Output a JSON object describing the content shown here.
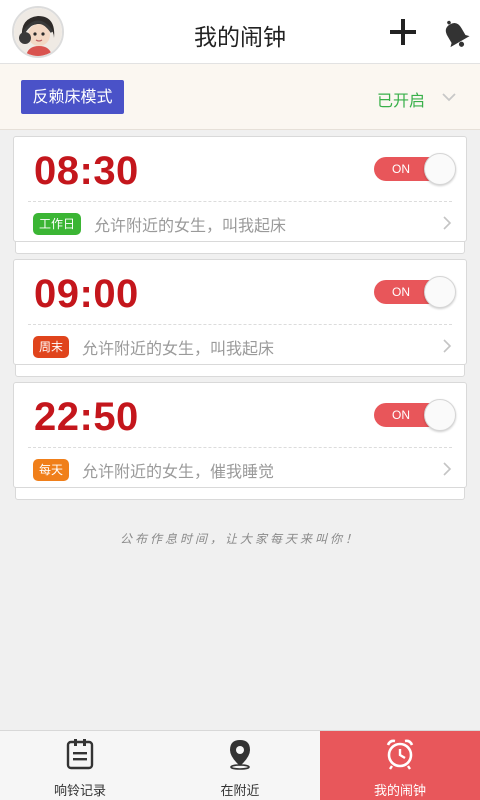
{
  "header": {
    "title": "我的闹钟",
    "add_icon": "plus-icon",
    "bell_icon": "bell-icon"
  },
  "mode": {
    "label": "反赖床模式",
    "status": "已开启"
  },
  "alarms": [
    {
      "time": "08:30",
      "toggle": "ON",
      "tag": "工作日",
      "tag_color": "#3bb534",
      "desc": "允许附近的女生，叫我起床"
    },
    {
      "time": "09:00",
      "toggle": "ON",
      "tag": "周末",
      "tag_color": "#e0441c",
      "desc": "允许附近的女生，叫我起床"
    },
    {
      "time": "22:50",
      "toggle": "ON",
      "tag": "每天",
      "tag_color": "#f07f1a",
      "desc": "允许附近的女生，催我睡觉"
    }
  ],
  "footer_note": "公布作息时间，让大家每天来叫你！",
  "tabs": [
    {
      "label": "响铃记录",
      "icon": "clipboard-icon"
    },
    {
      "label": "在附近",
      "icon": "location-pin-icon"
    },
    {
      "label": "我的闹钟",
      "icon": "alarm-clock-icon"
    }
  ],
  "colors": {
    "accent": "#e8575b",
    "time": "#c4161c",
    "mode_button": "#4a52c8",
    "status_green": "#39b04a"
  }
}
